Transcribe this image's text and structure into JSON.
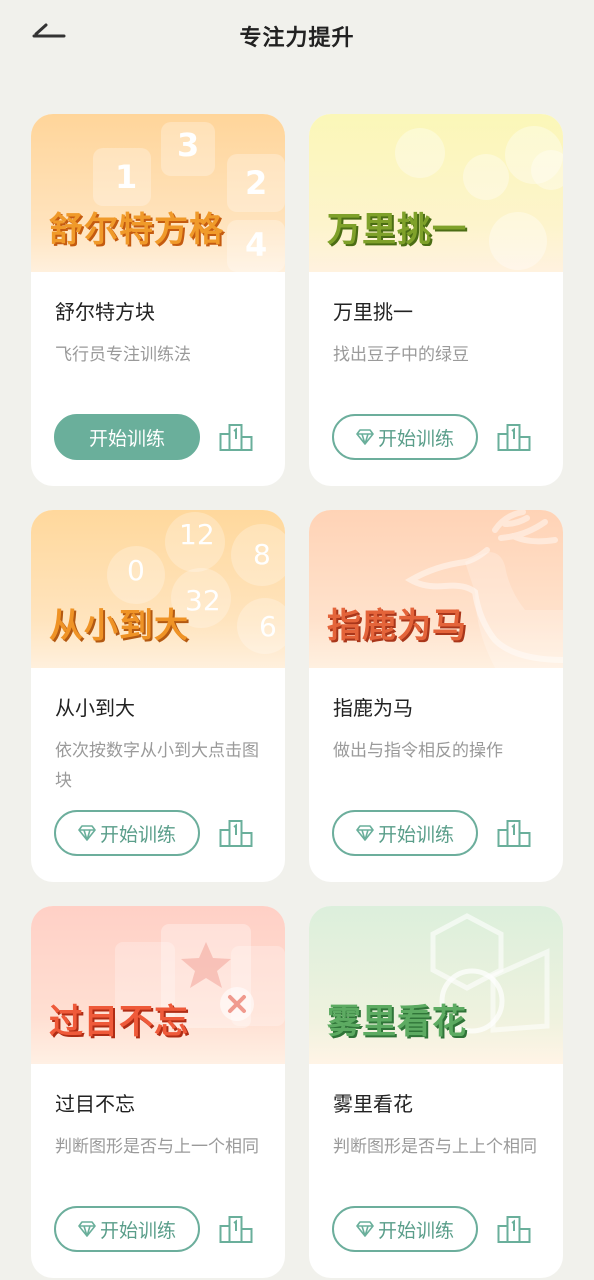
{
  "header": {
    "title": "专注力提升",
    "back_icon": "back-arrow-icon"
  },
  "cards": [
    {
      "banner_title": "舒尔特方格",
      "name": "舒尔特方块",
      "desc": "飞行员专注训练法",
      "button": "开始训练",
      "button_style": "filled",
      "deco_numbers": [
        "3",
        "1",
        "2",
        "4"
      ],
      "colors": {
        "bg_top": "#ffd59a",
        "bg_bottom": "#fff0dd",
        "title": "#f09a2a"
      }
    },
    {
      "banner_title": "万里挑一",
      "name": "万里挑一",
      "desc": "找出豆子中的绿豆",
      "button": "开始训练",
      "button_style": "outline",
      "colors": {
        "bg_top": "#fbf7b8",
        "bg_bottom": "#fff2df",
        "title": "#7fa12a"
      }
    },
    {
      "banner_title": "从小到大",
      "name": "从小到大",
      "desc": "依次按数字从小到大点击图块",
      "button": "开始训练",
      "button_style": "outline",
      "deco_numbers": [
        "12",
        "0",
        "8",
        "32",
        "6"
      ],
      "colors": {
        "bg_top": "#ffd89c",
        "bg_bottom": "#fff0dd",
        "title": "#ef9326"
      }
    },
    {
      "banner_title": "指鹿为马",
      "name": "指鹿为马",
      "desc": "做出与指令相反的操作",
      "button": "开始训练",
      "button_style": "outline",
      "colors": {
        "bg_top": "#ffd3b6",
        "bg_bottom": "#fff0e0",
        "title": "#e4643a"
      }
    },
    {
      "banner_title": "过目不忘",
      "name": "过目不忘",
      "desc": "判断图形是否与上一个相同",
      "button": "开始训练",
      "button_style": "outline",
      "colors": {
        "bg_top": "#ffd0c6",
        "bg_bottom": "#fff0e4",
        "title": "#ef5a3a"
      }
    },
    {
      "banner_title": "雾里看花",
      "name": "雾里看花",
      "desc": "判断图形是否与上上个相同",
      "button": "开始训练",
      "button_style": "outline",
      "colors": {
        "bg_top": "#dcefdc",
        "bg_bottom": "#fff4e6",
        "title": "#5dab62"
      }
    }
  ],
  "icons": {
    "gem": "diamond-icon",
    "rank": "podium-icon"
  },
  "accent": "#6aaf9b"
}
